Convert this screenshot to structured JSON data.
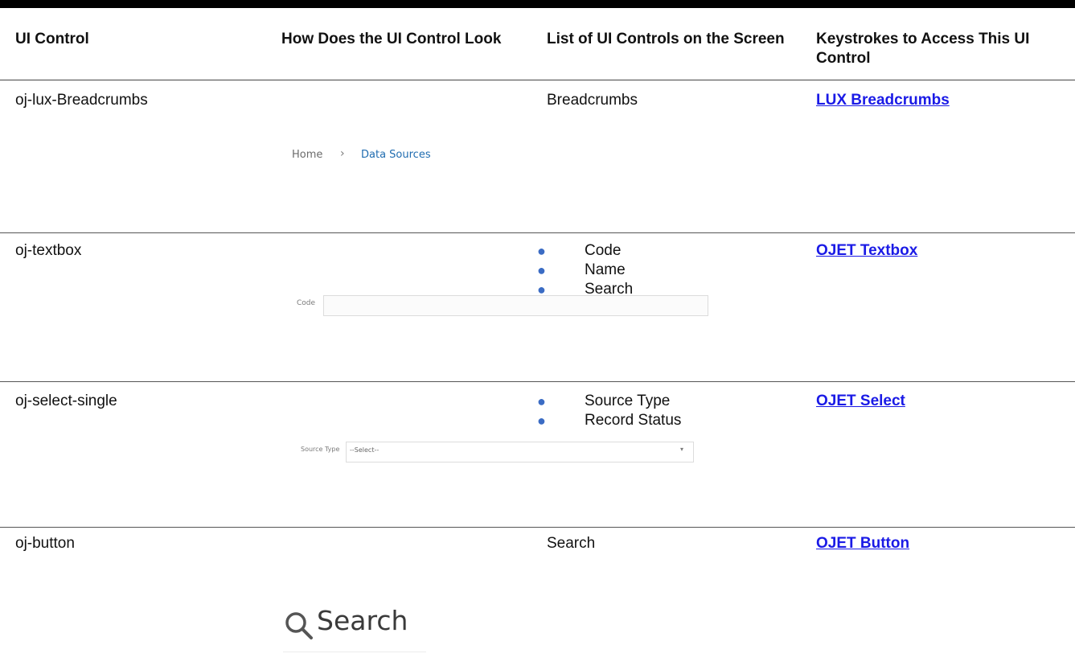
{
  "table": {
    "headers": [
      "UI Control",
      "How Does the UI Control Look",
      "List of UI Controls on the Screen",
      "Keystrokes to Access This UI Control"
    ],
    "rows": [
      {
        "control": "oj-lux-Breadcrumbs",
        "sample": {
          "home": "Home",
          "separator": "›",
          "current": "Data Sources"
        },
        "list_plain": "Breadcrumbs",
        "keystroke_link": "LUX Breadcrumbs"
      },
      {
        "control": "oj-textbox",
        "sample": {
          "label": "Code"
        },
        "list_items": [
          "Code",
          "Name",
          "Search"
        ],
        "keystroke_link": "OJET Textbox"
      },
      {
        "control": "oj-select-single",
        "sample": {
          "label": "Source Type",
          "value": "--Select--",
          "arrow": "▾"
        },
        "list_items": [
          "Source Type",
          "Record Status"
        ],
        "keystroke_link": "OJET Select"
      },
      {
        "control": "oj-button",
        "sample": {
          "label": "Search",
          "icon": "search-icon"
        },
        "list_plain": "Search",
        "keystroke_link": "OJET Button"
      }
    ]
  },
  "colors": {
    "link": "#1a1ae6",
    "bullet": "#3b6cc4",
    "breadcrumb_current": "#1f6cb0"
  }
}
